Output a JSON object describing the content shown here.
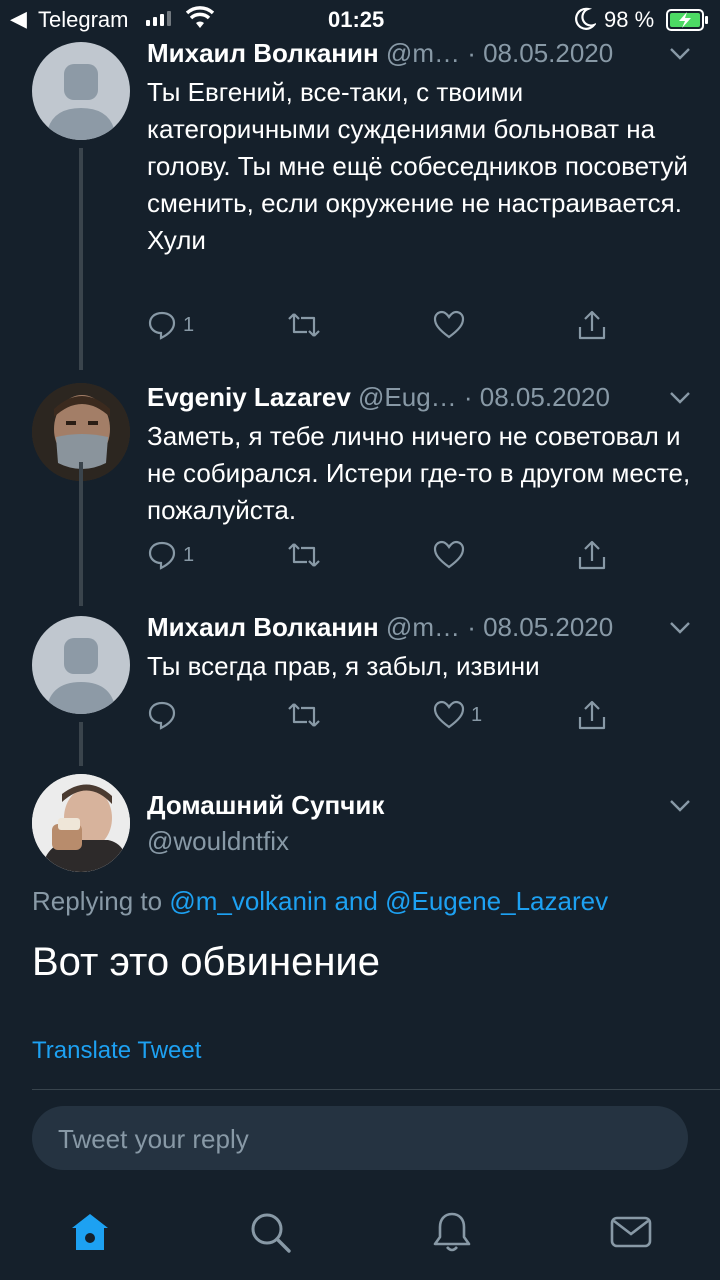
{
  "status_bar": {
    "back_app": "Telegram",
    "time": "01:25",
    "battery": "98 %"
  },
  "tweets": [
    {
      "name": "Михаил Волканин",
      "handle": "@m…",
      "date": "· 08.05.2020",
      "text": "Ты Евгений, все-таки, с твоими категоричными суждениями больноват на голову. Ты мне ещё собеседников посоветуй сменить, если окружение не настраивается. Хули",
      "reply_count": "1",
      "retweet_count": "",
      "like_count": ""
    },
    {
      "name": "Evgeniy Lazarev",
      "handle": "@Eug…",
      "date": "· 08.05.2020",
      "text": "Заметь, я тебе лично ничего не советовал и не собирался. Истери где-то в другом месте, пожалуйста.",
      "reply_count": "1",
      "retweet_count": "",
      "like_count": ""
    },
    {
      "name": "Михаил Волканин",
      "handle": "@m…",
      "date": "· 08.05.2020",
      "text": "Ты всегда прав, я забыл, извини",
      "reply_count": "",
      "retweet_count": "",
      "like_count": "1"
    }
  ],
  "main_tweet": {
    "name": "Домашний Супчик",
    "handle": "@wouldntfix",
    "replying_prefix": "Replying to",
    "replying_user1": "@m_volkanin",
    "replying_and": "and",
    "replying_user2": "@Eugene_Lazarev",
    "text": "Вот это обвинение",
    "translate": "Translate Tweet"
  },
  "reply_box": {
    "placeholder": "Tweet your reply"
  },
  "nav": {
    "tabs": [
      "home-icon",
      "search-icon",
      "bell-icon",
      "mail-icon"
    ],
    "active": "home-icon"
  },
  "colors": {
    "background": "#15202b",
    "accent": "#1da1f2",
    "secondary_text": "#8899a6",
    "reply_box": "#253341"
  }
}
